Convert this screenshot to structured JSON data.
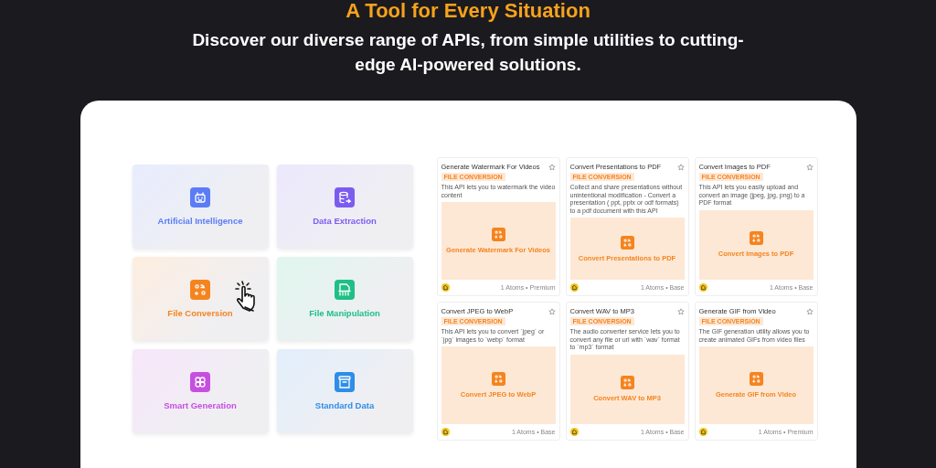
{
  "heading": "A Tool for Every Situation",
  "subheading": "Discover our diverse range of APIs, from simple utilities to cutting-edge AI-powered solutions.",
  "categories": [
    {
      "label": "Artificial Intelligence",
      "color": "#5b7cf6",
      "hovered": false
    },
    {
      "label": "Data Extraction",
      "color": "#7c5cf0",
      "hovered": false
    },
    {
      "label": "File Conversion",
      "color": "#f5841f",
      "hovered": true
    },
    {
      "label": "File Manipulation",
      "color": "#1fbf86",
      "hovered": false
    },
    {
      "label": "Smart Generation",
      "color": "#c64fe0",
      "hovered": false
    },
    {
      "label": "Standard Data",
      "color": "#2e8de8",
      "hovered": false
    }
  ],
  "apis": [
    {
      "title": "Generate Watermark For Videos",
      "tag": "FILE CONVERSION",
      "description": "This API lets you to watermark the video content",
      "banner": "Generate Watermark For Videos",
      "footer": "1 Atoms • Premium"
    },
    {
      "title": "Convert Presentations to PDF",
      "tag": "FILE CONVERSION",
      "description": "Collect and share presentations without unintentional modification - Convert a presentation ( ppt, pptx or odf formats) to a pdf document with this API",
      "banner": "Convert Presentations to PDF",
      "footer": "1 Atoms • Base"
    },
    {
      "title": "Convert Images to PDF",
      "tag": "FILE CONVERSION",
      "description": "This API lets you easily upload and convert an image (jpeg, jpg, png) to a PDF format",
      "banner": "Convert Images to PDF",
      "footer": "1 Atoms • Base"
    },
    {
      "title": "Convert JPEG to WebP",
      "tag": "FILE CONVERSION",
      "description": "This API lets you to convert `jpeg` or `jpg` images to `webp` format",
      "banner": "Convert JPEG to WebP",
      "footer": "1 Atoms • Base"
    },
    {
      "title": "Convert WAV to MP3",
      "tag": "FILE CONVERSION",
      "description": "The audio converter service lets you to convert any file or url with `wav` format to `mp3` format",
      "banner": "Convert WAV to MP3",
      "footer": "1 Atoms • Base"
    },
    {
      "title": "Generate GIF from Video",
      "tag": "FILE CONVERSION",
      "description": "The GIF generation utility allows you to create animated GIFs from video files",
      "banner": "Generate GIF from Video",
      "footer": "1 Atoms • Premium"
    }
  ]
}
